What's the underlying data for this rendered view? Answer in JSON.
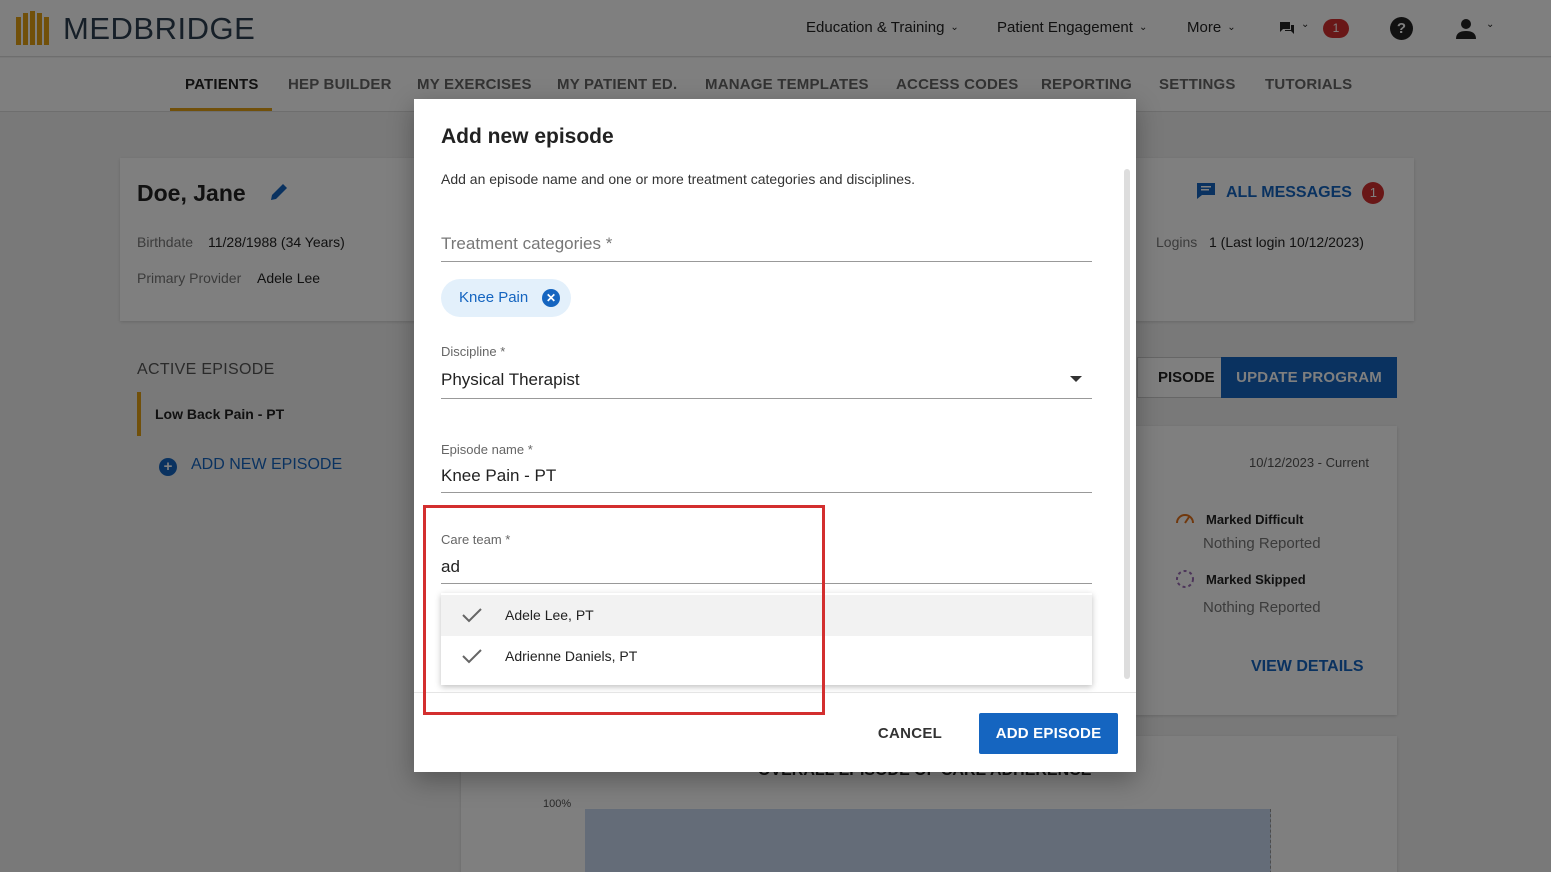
{
  "header": {
    "brand": "MEDBRIDGE",
    "nav": [
      "Education & Training",
      "Patient Engagement",
      "More"
    ],
    "notification_count": "1",
    "help_label": "?"
  },
  "subnav": {
    "tabs": [
      "PATIENTS",
      "HEP BUILDER",
      "MY EXERCISES",
      "MY PATIENT ED.",
      "MANAGE TEMPLATES",
      "ACCESS CODES",
      "REPORTING",
      "SETTINGS",
      "TUTORIALS"
    ],
    "active": "PATIENTS"
  },
  "patient": {
    "name": "Doe, Jane",
    "birthdate_label": "Birthdate",
    "birthdate": "11/28/1988 (34 Years)",
    "provider_label": "Primary Provider",
    "provider": "Adele Lee",
    "logins_label": "Logins",
    "logins": "1 (Last login 10/12/2023)"
  },
  "messages": {
    "label": "ALL MESSAGES",
    "count": "1"
  },
  "episodes": {
    "section_label": "ACTIVE EPISODE",
    "items": [
      "Low Back Pain - PT"
    ],
    "add_label": "ADD NEW EPISODE"
  },
  "actions": {
    "episode_button": "PISODE",
    "update_program": "UPDATE PROGRAM"
  },
  "program": {
    "date_range": "10/12/2023 - Current",
    "marked_difficult_label": "Marked Difficult",
    "marked_difficult_value": "Nothing Reported",
    "marked_skipped_label": "Marked Skipped",
    "marked_skipped_value": "Nothing Reported",
    "view_details": "VIEW DETAILS",
    "adherence_title": "OVERALL EPISODE OF CARE ADHERENCE",
    "adherence_axis_top": "100%"
  },
  "modal": {
    "title": "Add new episode",
    "subtitle": "Add an episode name and one or more treatment categories and disciplines.",
    "treatment_categories_label": "Treatment categories *",
    "selected_categories": [
      "Knee Pain"
    ],
    "discipline_label": "Discipline *",
    "discipline_value": "Physical Therapist",
    "episode_name_label": "Episode name *",
    "episode_name_value": "Knee Pain - PT",
    "care_team_label": "Care team *",
    "care_team_query": "ad",
    "care_team_suggestions": [
      "Adele Lee, PT",
      "Adrienne Daniels, PT"
    ],
    "cancel_label": "CANCEL",
    "submit_label": "ADD EPISODE"
  },
  "colors": {
    "accent": "#1565c0",
    "tab_underline": "#e3a015",
    "alert": "#d32f2f"
  }
}
